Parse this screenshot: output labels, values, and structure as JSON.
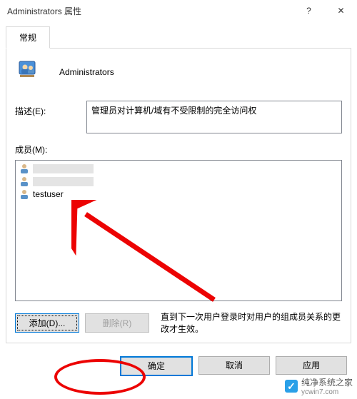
{
  "title": "Administrators 属性",
  "tabs": {
    "general": "常规"
  },
  "group": {
    "name": "Administrators"
  },
  "desc": {
    "label": "描述(E):",
    "value": "管理员对计算机/域有不受限制的完全访问权"
  },
  "members": {
    "label": "成员(M):",
    "items": [
      {
        "name": "(隐藏)"
      },
      {
        "name": "(隐藏)"
      },
      {
        "name": "testuser"
      }
    ]
  },
  "buttons": {
    "add": "添加(D)...",
    "remove": "删除(R)",
    "note": "直到下一次用户登录时对用户的组成员关系的更改才生效。",
    "ok": "确定",
    "cancel": "取消",
    "apply": "应用"
  },
  "titlebar": {
    "help": "?",
    "close": "✕"
  },
  "watermark": {
    "text": "纯净系统之家",
    "url": "ycwin7.com"
  }
}
